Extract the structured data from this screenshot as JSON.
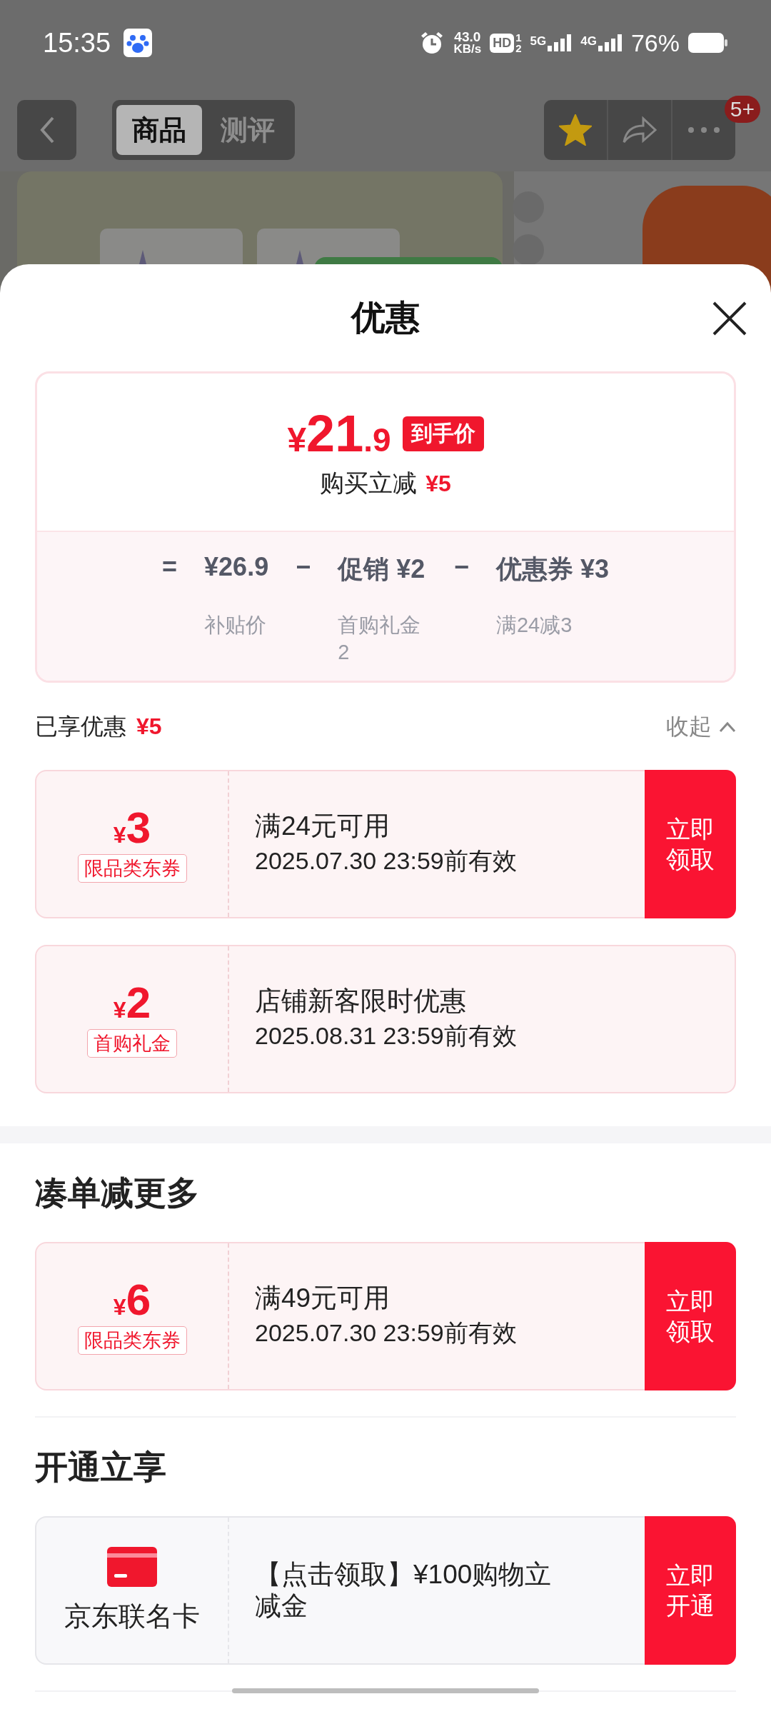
{
  "status_bar": {
    "time": "15:35",
    "speed": "43.0",
    "speed_unit": "KB/s",
    "hd": "HD",
    "hd_slots": [
      "1",
      "2"
    ],
    "networks": [
      "5G",
      "4G"
    ],
    "battery": "76%"
  },
  "nav": {
    "tabs": [
      {
        "label": "商品",
        "selected": true
      },
      {
        "label": "测评",
        "selected": false
      }
    ],
    "favorited": true,
    "badge": "5+"
  },
  "sheet": {
    "title": "优惠",
    "price": {
      "currency": "¥",
      "integer": "21",
      "decimal": ".9",
      "tag": "到手价",
      "saving_label": "购买立减",
      "saving": "¥5",
      "breakdown": [
        {
          "sign": "=",
          "amount": "¥26.9",
          "note": "补贴价"
        },
        {
          "sign": "−",
          "amount": "促销 ¥2",
          "note": "首购礼金2"
        },
        {
          "sign": "−",
          "amount": "优惠券 ¥3",
          "note": "满24减3"
        }
      ]
    },
    "enjoyed": {
      "label": "已享优惠",
      "amount": "¥5",
      "toggle": "收起",
      "expanded": true,
      "offers": [
        {
          "kind": "coupon",
          "currency": "¥",
          "value": "3",
          "tag": "限品类东券",
          "title": "满24元可用",
          "validity": "2025.07.30 23:59前有效",
          "action": "立即领取"
        },
        {
          "kind": "coupon",
          "currency": "¥",
          "value": "2",
          "tag": "首购礼金",
          "title": "店铺新客限时优惠",
          "validity": "2025.08.31 23:59前有效"
        }
      ]
    },
    "sections": [
      {
        "title": "凑单减更多",
        "offers": [
          {
            "kind": "coupon",
            "currency": "¥",
            "value": "6",
            "tag": "限品类东券",
            "title": "满49元可用",
            "validity": "2025.07.30 23:59前有效",
            "action": "立即领取"
          }
        ]
      },
      {
        "title": "开通立享",
        "offers": [
          {
            "kind": "card",
            "name": "京东联名卡",
            "title": "【点击领取】¥100购物立减金",
            "action": "立即开通"
          }
        ]
      }
    ]
  }
}
